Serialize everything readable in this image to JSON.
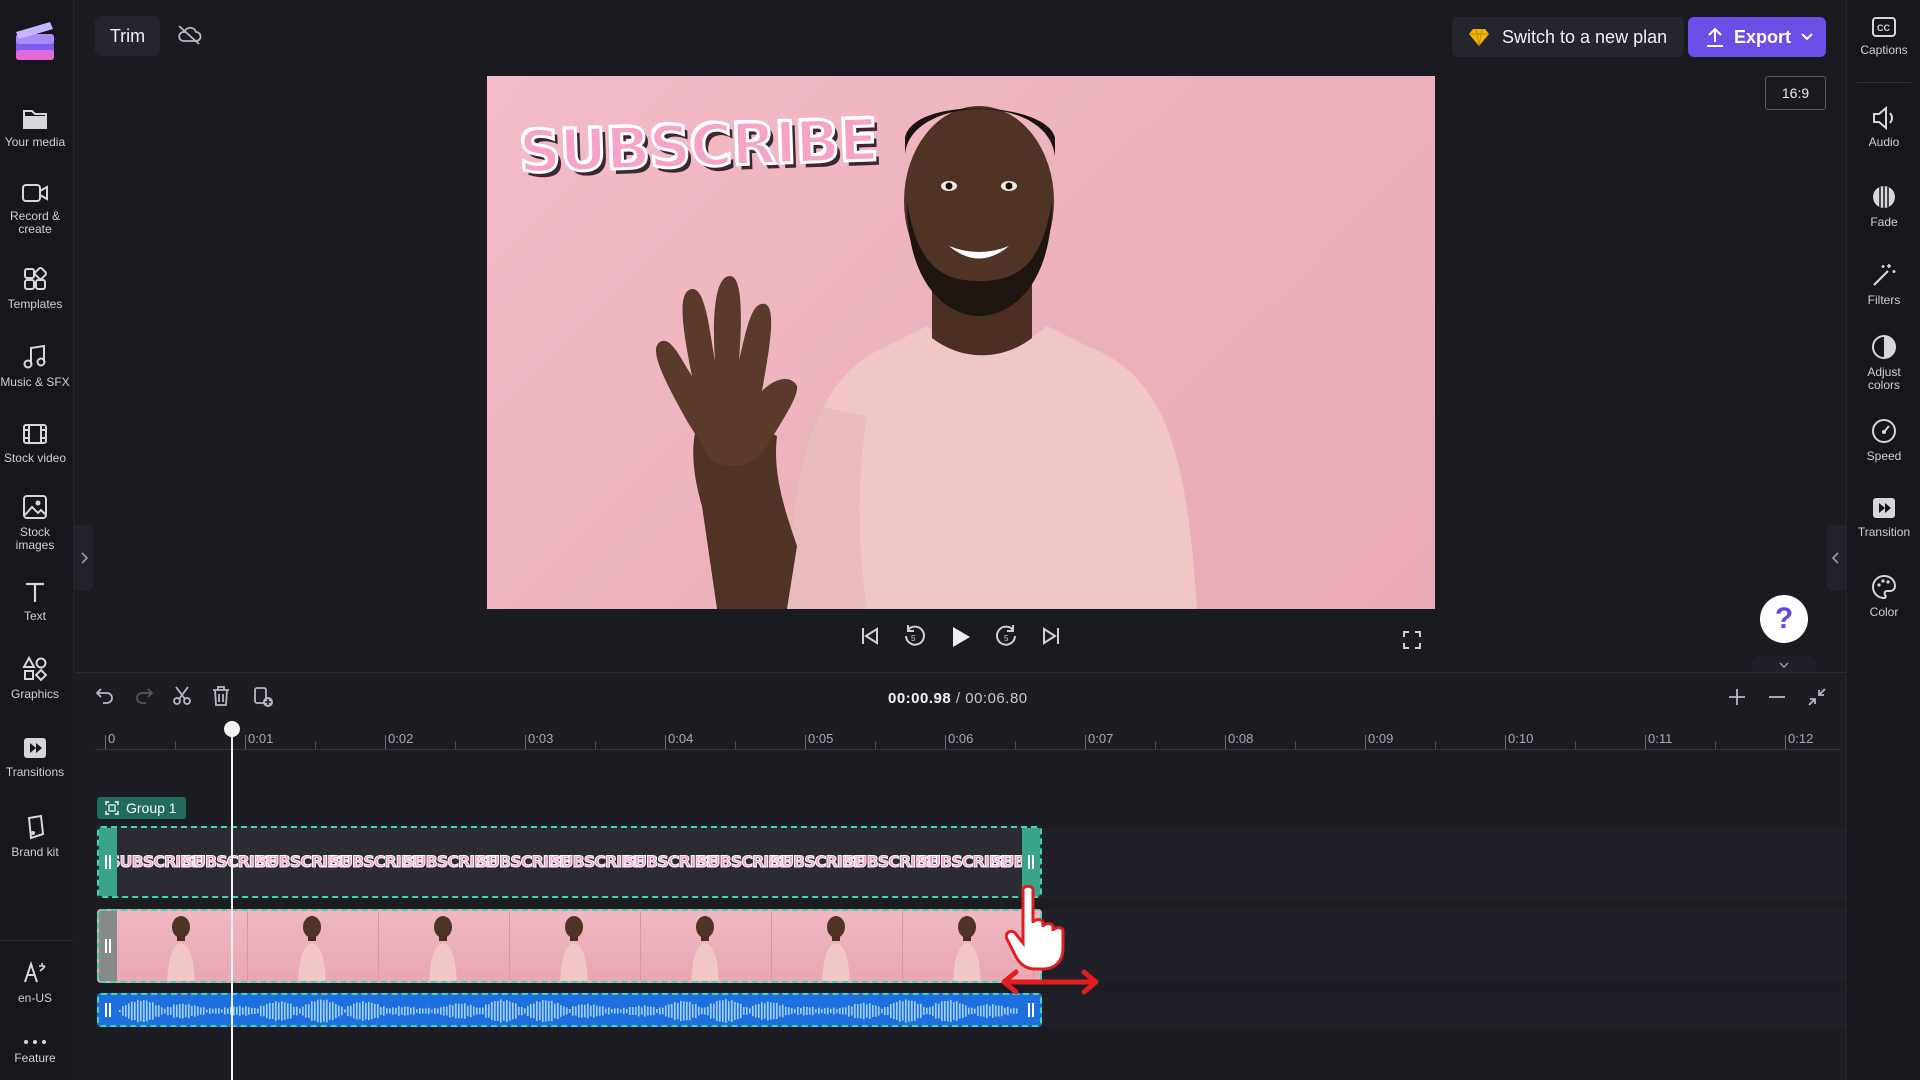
{
  "app": {
    "brand_color": "#6b4ee6",
    "group_color": "#1f6b5e",
    "clip_border_color": "#3fd6b0"
  },
  "left_sidebar": {
    "items": [
      {
        "label": "Your media",
        "icon": "folder-icon"
      },
      {
        "label": "Record &",
        "label2": "create",
        "icon": "camera-icon"
      },
      {
        "label": "Templates",
        "icon": "templates-icon"
      },
      {
        "label": "Music & SFX",
        "icon": "music-icon"
      },
      {
        "label": "Stock video",
        "icon": "film-icon"
      },
      {
        "label": "Stock",
        "label2": "images",
        "icon": "image-icon"
      },
      {
        "label": "Text",
        "icon": "text-icon"
      },
      {
        "label": "Graphics",
        "icon": "shapes-icon"
      },
      {
        "label": "Transitions",
        "icon": "transition-icon"
      },
      {
        "label": "Brand kit",
        "icon": "brand-icon"
      },
      {
        "label": "en-US",
        "icon": "language-icon"
      },
      {
        "label": "Feature",
        "icon": "more-icon"
      }
    ]
  },
  "right_sidebar": {
    "items": [
      {
        "label": "Captions",
        "icon": "captions-icon"
      },
      {
        "label": "Audio",
        "icon": "speaker-icon"
      },
      {
        "label": "Fade",
        "icon": "fade-icon"
      },
      {
        "label": "Filters",
        "icon": "wand-icon"
      },
      {
        "label": "Adjust",
        "label2": "colors",
        "icon": "contrast-icon"
      },
      {
        "label": "Speed",
        "icon": "gauge-icon"
      },
      {
        "label": "Transition",
        "icon": "transition-icon"
      },
      {
        "label": "Color",
        "icon": "palette-icon"
      }
    ]
  },
  "toolbar": {
    "trim_label": "Trim",
    "plan_label": "Switch to a new plan",
    "export_label": "Export",
    "aspect_ratio": "16:9"
  },
  "preview": {
    "sticker_text": "SUBSCRIBE"
  },
  "help": {
    "label": "?"
  },
  "timeline": {
    "current_time": "00:00.98",
    "separator": " / ",
    "total_time": "00:06.80",
    "ruler_labels": [
      "0",
      "0:01",
      "0:02",
      "0:03",
      "0:04",
      "0:05",
      "0:06",
      "0:07",
      "0:08",
      "0:09",
      "0:10",
      "0:11",
      "0:12"
    ],
    "group_label": "Group 1",
    "sticker_clip_text": "SUBSCRIBE"
  }
}
